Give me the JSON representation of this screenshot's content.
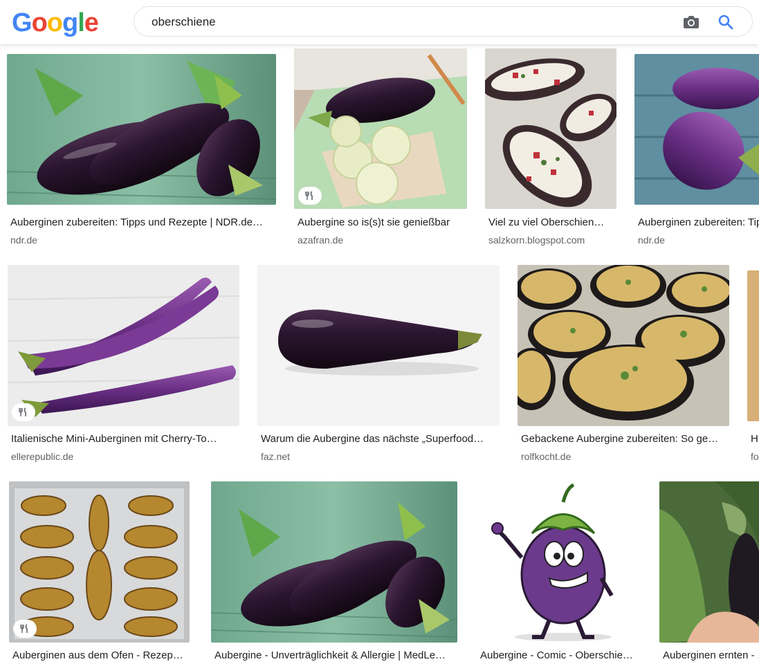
{
  "header": {
    "logo_letters": [
      "G",
      "o",
      "o",
      "g",
      "l",
      "e"
    ],
    "logo_colors": [
      "#4285f4",
      "#ea4335",
      "#fbbc05",
      "#4285f4",
      "#34a853",
      "#ea4335"
    ],
    "search_value": "oberschiene",
    "camera_icon": "camera-icon",
    "search_icon": "search-icon"
  },
  "colors": {
    "accent": "#4285f4",
    "title_text": "#202124",
    "source_text": "#5f6368"
  },
  "results": [
    {
      "title": "Auberginen zubereiten: Tipps und Rezepte | NDR.de…",
      "source": "ndr.de",
      "recipe_badge": false,
      "image": "two eggplants on wooden table"
    },
    {
      "title": "Aubergine so is(s)t sie genießbar",
      "source": "azafran.de",
      "recipe_badge": true,
      "image": "eggplant with slices on board"
    },
    {
      "title": "Viel zu viel Oberschien…",
      "source": "salzkorn.blogspot.com",
      "recipe_badge": false,
      "image": "stuffed baked eggplants"
    },
    {
      "title": "Auberginen zubereiten: Tipps und Rezepte | NDR.de…",
      "source": "ndr.de",
      "recipe_badge": false,
      "image": "striped eggplants"
    },
    {
      "title": "Italienische Mini-Auberginen mit Cherry-To…",
      "source": "ellerepublic.de",
      "recipe_badge": true,
      "image": "long purple eggplants"
    },
    {
      "title": "Warum die Aubergine das nächste „Superfood…",
      "source": "faz.net",
      "recipe_badge": false,
      "image": "single eggplant on white"
    },
    {
      "title": "Gebackene Aubergine zubereiten: So ge…",
      "source": "rolfkocht.de",
      "recipe_badge": false,
      "image": "baked eggplant slices"
    },
    {
      "title": "H…",
      "source": "fo…",
      "recipe_badge": false,
      "image": "partial image"
    },
    {
      "title": "Auberginen aus dem Ofen - Rezep…",
      "source": "",
      "recipe_badge": true,
      "image": "roasted eggplant on tray"
    },
    {
      "title": "Aubergine - Unverträglichkeit & Allergie | MedLe…",
      "source": "",
      "recipe_badge": false,
      "image": "two eggplants on wooden table"
    },
    {
      "title": "Aubergine - Comic - Oberschie…",
      "source": "",
      "recipe_badge": false,
      "image": "cartoon eggplant character"
    },
    {
      "title": "Auberginen ernten - …",
      "source": "",
      "recipe_badge": false,
      "image": "eggplant on plant in hand"
    }
  ]
}
